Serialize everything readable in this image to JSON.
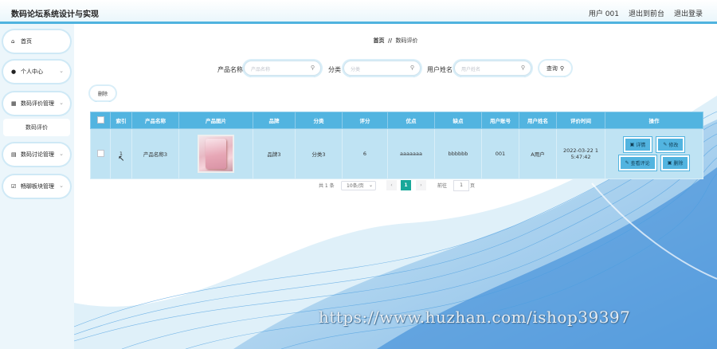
{
  "app": {
    "title": "数码论坛系统设计与实现"
  },
  "header": {
    "user": "用户 001",
    "back_front": "退出到前台",
    "logout": "退出登录"
  },
  "sidebar": {
    "items": [
      {
        "label": "首页",
        "icon": "home-icon"
      },
      {
        "label": "个人中心",
        "icon": "user-icon"
      },
      {
        "label": "数码评价管理",
        "icon": "grid-icon"
      },
      {
        "label": "数码评价",
        "icon": ""
      },
      {
        "label": "数码讨论管理",
        "icon": "list-icon"
      },
      {
        "label": "畅聊板块管理",
        "icon": "checkbox-icon"
      }
    ]
  },
  "breadcrumb": {
    "home": "首页",
    "sep": "//",
    "current": "数码评价"
  },
  "search": {
    "name_label": "产品名称",
    "name_placeholder": "产品名称",
    "cat_label": "分类",
    "cat_placeholder": "分类",
    "user_label": "用户姓名",
    "user_placeholder": "用户姓名",
    "query_label": "查询"
  },
  "toolbar": {
    "delete_label": "删除"
  },
  "table": {
    "headers": [
      "",
      "索引",
      "产品名称",
      "产品图片",
      "品牌",
      "分类",
      "评分",
      "优点",
      "缺点",
      "用户账号",
      "用户姓名",
      "评价时间",
      "操作"
    ],
    "row": {
      "index": "1",
      "name": "产品名称3",
      "brand": "品牌3",
      "category": "分类3",
      "score": "6",
      "pros": "aaaaaaa",
      "cons": "bbbbbb",
      "account": "001",
      "username": "A用户",
      "time_line1": "2022-03-22 1",
      "time_line2": "5:47:42",
      "actions": {
        "detail": "详情",
        "edit": "修改",
        "view_comments": "查看评论",
        "delete": "删除"
      }
    }
  },
  "pagination": {
    "total": "共 1 条",
    "page_size": "10条/页",
    "current": "1",
    "goto_label": "前往",
    "goto_value": "1",
    "page_unit": "页"
  },
  "watermark": "https://www.huzhan.com/ishop39397",
  "colors": {
    "accent": "#52b4e0",
    "row_bg": "#bfe3f3",
    "active_page": "#19a89a"
  }
}
